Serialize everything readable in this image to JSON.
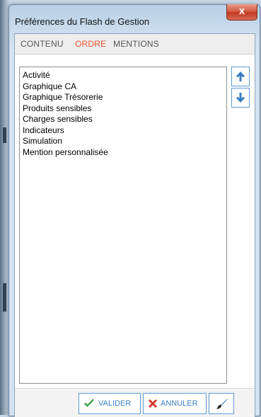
{
  "window": {
    "title": "Préférences du Flash de Gestion",
    "close_glyph": "x"
  },
  "tabs": [
    {
      "label": "CONTENU",
      "active": false
    },
    {
      "label": "ORDRE",
      "active": true
    },
    {
      "label": "MENTIONS",
      "active": false
    }
  ],
  "order_list": {
    "items": [
      "Activité",
      "Graphique CA",
      "Graphique Trésorerie",
      "Produits sensibles",
      "Charges sensibles",
      "Indicateurs",
      "Simulation",
      "Mention personnalisée"
    ]
  },
  "side_buttons": {
    "up_icon": "arrow-up-icon",
    "down_icon": "arrow-down-icon"
  },
  "footer": {
    "valider_label": "VALIDER",
    "annuler_label": "ANNULER",
    "valider_icon": "check-icon",
    "annuler_icon": "x-icon",
    "reset_icon": "brush-icon"
  },
  "colors": {
    "accent": "#3b7ec2",
    "active_tab": "#e8532e",
    "check_green": "#3fa34d",
    "cancel_red": "#d8342a",
    "close_red": "#c13a22"
  }
}
